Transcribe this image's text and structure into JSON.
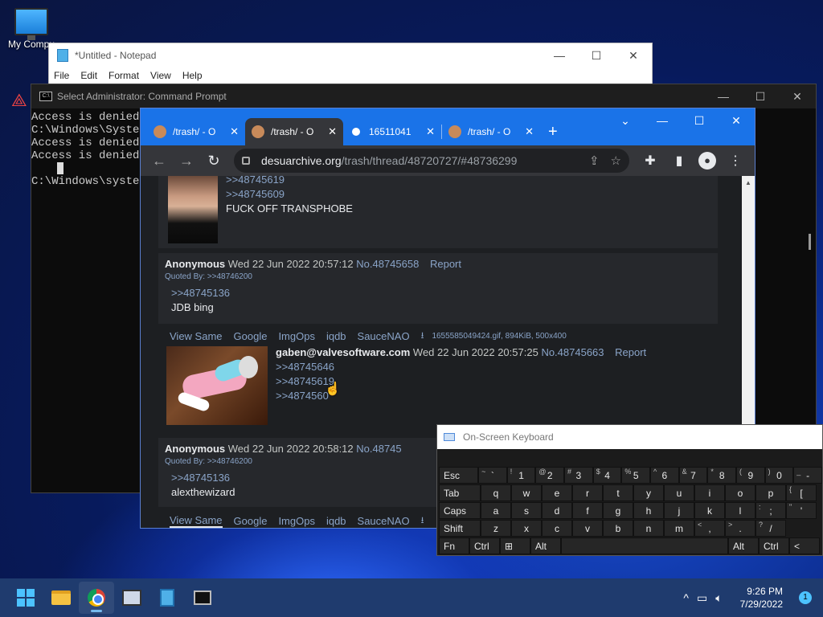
{
  "desktop": {
    "icon_label": "My Compu"
  },
  "notepad": {
    "title": "*Untitled - Notepad",
    "menu": [
      "File",
      "Edit",
      "Format",
      "View",
      "Help"
    ]
  },
  "cmd": {
    "title": "Select Administrator: Command Prompt",
    "lines": [
      "Access is denied.",
      "C:\\Windows\\System",
      "Access is denied.",
      "Access is denied.",
      "",
      "",
      "C:\\Windows\\system"
    ]
  },
  "chrome": {
    "tabs": [
      {
        "title": "/trash/ - O",
        "active": false,
        "icon": "4chan-icon"
      },
      {
        "title": "/trash/ - O",
        "active": true,
        "icon": "4chan-icon"
      },
      {
        "title": "16511041",
        "active": false,
        "icon": "globe-icon"
      },
      {
        "title": "/trash/ - O",
        "active": false,
        "icon": "4chan-icon"
      }
    ],
    "url_host": "desuarchive.org",
    "url_path": "/trash/thread/48720727/#48736299",
    "new_tab": "+"
  },
  "posts": {
    "p1": {
      "quotes": [
        ">>48745619",
        ">>48745609"
      ],
      "text": "FUCK OFF TRANSPHOBE"
    },
    "p2": {
      "name": "Anonymous",
      "date": "Wed 22 Jun 2022 20:57:12",
      "no": "No.48745658",
      "report": "Report",
      "quoted_by_label": "Quoted By:",
      "quoted_by": ">>48746200",
      "quotes": [
        ">>48745136"
      ],
      "text": "JDB bing"
    },
    "linkbar1": {
      "links": [
        "View Same",
        "Google",
        "ImgOps",
        "iqdb",
        "SauceNAO"
      ],
      "file": "1655585049424.gif, 894KiB, 500x400"
    },
    "p3": {
      "name": "gaben@valvesoftware.com",
      "date": "Wed 22 Jun 2022 20:57:25",
      "no": "No.48745663",
      "report": "Report",
      "quotes": [
        ">>48745646",
        ">>48745619",
        ">>4874560"
      ]
    },
    "p4": {
      "name": "Anonymous",
      "date": "Wed 22 Jun 2022 20:58:12",
      "no": "No.48745",
      "quoted_by_label": "Quoted By:",
      "quoted_by": ">>48746200",
      "quotes": [
        ">>48745136"
      ],
      "text": "alexthewizard"
    },
    "linkbar2": {
      "links": [
        "View Same",
        "Google",
        "ImgOps",
        "iqdb",
        "SauceNAO"
      ]
    }
  },
  "osk": {
    "title": "On-Screen Keyboard",
    "rows": [
      [
        [
          "Esc",
          ""
        ],
        [
          "~",
          "`"
        ],
        [
          "!",
          "1"
        ],
        [
          "@",
          "2"
        ],
        [
          "#",
          "3"
        ],
        [
          "$",
          "4"
        ],
        [
          "%",
          "5"
        ],
        [
          "^",
          "6"
        ],
        [
          "&",
          "7"
        ],
        [
          "*",
          "8"
        ],
        [
          "(",
          "9"
        ],
        [
          ")",
          "0"
        ],
        [
          "_",
          "-"
        ]
      ],
      [
        [
          "Tab",
          ""
        ],
        [
          "",
          "q"
        ],
        [
          "",
          "w"
        ],
        [
          "",
          "e"
        ],
        [
          "",
          "r"
        ],
        [
          "",
          "t"
        ],
        [
          "",
          "y"
        ],
        [
          "",
          "u"
        ],
        [
          "",
          "i"
        ],
        [
          "",
          "o"
        ],
        [
          "",
          "p"
        ],
        [
          "{",
          "["
        ]
      ],
      [
        [
          "Caps",
          ""
        ],
        [
          "",
          "a"
        ],
        [
          "",
          "s"
        ],
        [
          "",
          "d"
        ],
        [
          "",
          "f"
        ],
        [
          "",
          "g"
        ],
        [
          "",
          "h"
        ],
        [
          "",
          "j"
        ],
        [
          "",
          "k"
        ],
        [
          "",
          "l"
        ],
        [
          ":",
          ";"
        ],
        [
          "\"",
          "'"
        ]
      ],
      [
        [
          "Shift",
          ""
        ],
        [
          "",
          "z"
        ],
        [
          "",
          "x"
        ],
        [
          "",
          "c"
        ],
        [
          "",
          "v"
        ],
        [
          "",
          "b"
        ],
        [
          "",
          "n"
        ],
        [
          "",
          "m"
        ],
        [
          "<",
          ","
        ],
        [
          ">",
          "."
        ],
        [
          "?",
          "/"
        ]
      ],
      [
        [
          "Fn",
          ""
        ],
        [
          "Ctrl",
          ""
        ],
        [
          "⊞",
          ""
        ],
        [
          "Alt",
          ""
        ],
        [
          "",
          ""
        ],
        [
          "Alt",
          ""
        ],
        [
          "Ctrl",
          ""
        ],
        [
          "<",
          ""
        ]
      ]
    ]
  },
  "taskbar": {
    "time": "9:26 PM",
    "date": "7/29/2022",
    "notifications": "1",
    "colors": {
      "accent": "#4cc2ff",
      "bar": "#1f3b6e"
    }
  }
}
